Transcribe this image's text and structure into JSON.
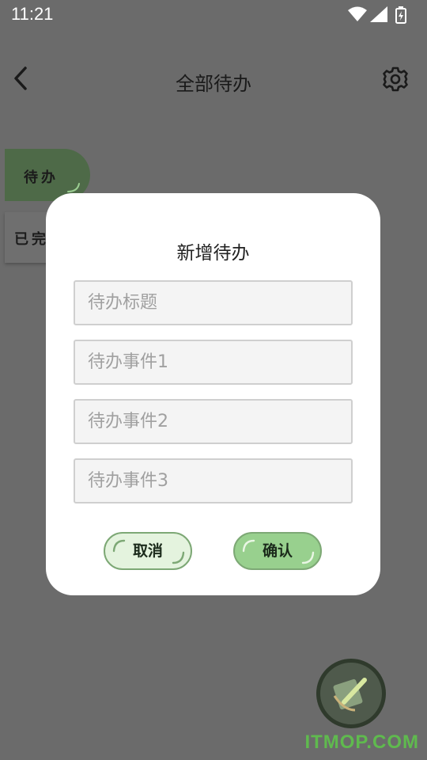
{
  "status_bar": {
    "time": "11:21",
    "icons": [
      "wifi-icon",
      "signal-icon",
      "battery-charging-icon"
    ]
  },
  "header": {
    "title": "全部待办",
    "back_icon": "chevron-left-icon",
    "settings_icon": "gear-icon"
  },
  "tabs": [
    {
      "label": "待办",
      "selected": true
    },
    {
      "label": "已完成",
      "selected": false
    }
  ],
  "dialog": {
    "title": "新增待办",
    "fields": [
      {
        "placeholder": "待办标题",
        "value": ""
      },
      {
        "placeholder": "待办事件1",
        "value": ""
      },
      {
        "placeholder": "待办事件2",
        "value": ""
      },
      {
        "placeholder": "待办事件3",
        "value": ""
      }
    ],
    "cancel_label": "取消",
    "confirm_label": "确认"
  },
  "fab": {
    "icon": "note-pencil-icon"
  },
  "watermark": "ITMOP.COM",
  "colors": {
    "accent_green": "#98d08e",
    "light_green": "#e4f3de",
    "dim_overlay": "#6b6b6b",
    "tab_selected": "#4e6a48"
  }
}
